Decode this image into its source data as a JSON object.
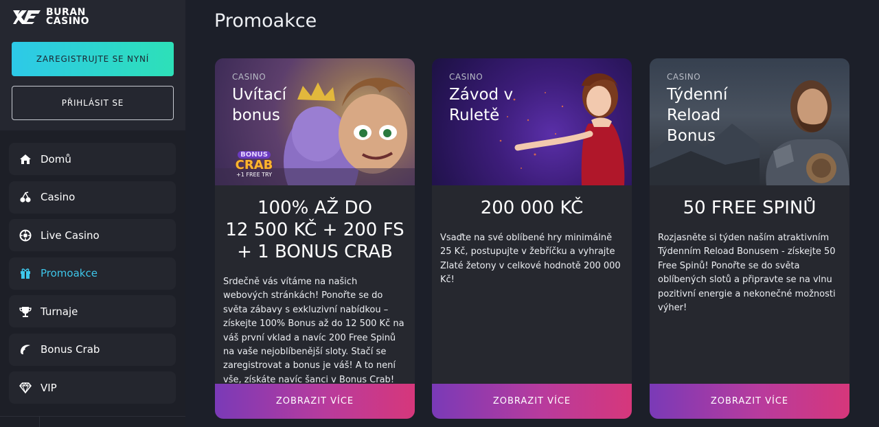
{
  "brand": {
    "line1": "BURAN",
    "line2": "CASINO"
  },
  "auth": {
    "register_label": "ZAREGISTRUJTE SE NYNÍ",
    "login_label": "PŘIHLÁSIT SE"
  },
  "nav": {
    "items": [
      {
        "label": "Domů",
        "icon": "home-icon"
      },
      {
        "label": "Casino",
        "icon": "cherries-icon"
      },
      {
        "label": "Live Casino",
        "icon": "roulette-icon"
      },
      {
        "label": "Promoakce",
        "icon": "gift-icon"
      },
      {
        "label": "Turnaje",
        "icon": "trophy-icon"
      },
      {
        "label": "Bonus Crab",
        "icon": "crab-claw-icon"
      },
      {
        "label": "VIP",
        "icon": "diamond-icon"
      }
    ],
    "active_color": "#3ec6ea"
  },
  "page": {
    "title": "Promoakce"
  },
  "promos": [
    {
      "category": "CASINO",
      "image_title": "Uvítací bonus",
      "badge": {
        "line1": "BONUS",
        "line2": "CRAB",
        "line3": "+1 FREE TRY"
      },
      "headline_lines": [
        "100% AŽ DO",
        "12 500 KČ + 200 FS",
        "+ 1 BONUS CRAB"
      ],
      "description": "Srdečně vás vítáme na našich webových stránkách! Ponořte se do světa zábavy s exkluzivní nabídkou – získejte 100% Bonus až do 12 500 Kč na váš první vklad a navíc 200 Free Spinů na vaše nejoblíbenější sloty. Stačí se zaregistrovat a bonus je váš! A to není vše, získáte navíc šanci v Bonus Crab!",
      "button_label": "ZOBRAZIT VÍCE"
    },
    {
      "category": "CASINO",
      "image_title": "Závod v Ruletě",
      "headline_lines": [
        "200 000 KČ"
      ],
      "description": "Vsaďte na své oblíbené hry minimálně 25 Kč, postupujte v žebříčku a vyhrajte Zlaté žetony v celkové hodnotě 200 000 Kč!",
      "button_label": "ZOBRAZIT VÍCE"
    },
    {
      "category": "CASINO",
      "image_title": "Týdenní Reload Bonus",
      "headline_lines": [
        "50 FREE SPINŮ"
      ],
      "description": "Rozjasněte si týden naším atraktivním Týdenním Reload Bonusem - získejte 50 Free Spinů! Ponořte se do světa oblíbených slotů a připravte se na vlnu pozitivní energie a nekonečné možnosti výher!",
      "button_label": "ZOBRAZIT VÍCE"
    }
  ],
  "colors": {
    "register_gradient": [
      "#2dc9e8",
      "#2de0b8"
    ],
    "cta_gradient": [
      "#7a3ab7",
      "#d6377b"
    ]
  }
}
